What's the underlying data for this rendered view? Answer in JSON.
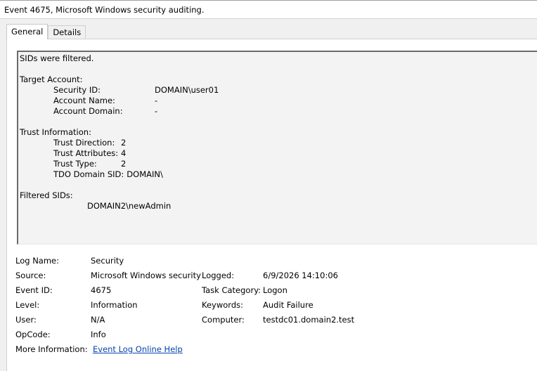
{
  "window": {
    "title": "Event 4675, Microsoft Windows security auditing."
  },
  "tabs": [
    {
      "label": "General",
      "active": true
    },
    {
      "label": "Details",
      "active": false
    }
  ],
  "description": {
    "line1": "SIDs were filtered.",
    "target_account": {
      "heading": "Target Account:",
      "security_id_label": "Security ID:",
      "security_id_value": "DOMAIN\\user01",
      "account_name_label": "Account Name:",
      "account_name_value": "-",
      "account_domain_label": "Account Domain:",
      "account_domain_value": "-"
    },
    "trust_information": {
      "heading": "Trust Information:",
      "direction_label": "Trust Direction:",
      "direction_value": "2",
      "attributes_label": "Trust Attributes:",
      "attributes_value": "4",
      "type_label": "Trust Type:",
      "type_value": "2",
      "tdo_sid_label": "TDO Domain SID:",
      "tdo_sid_value": "DOMAIN\\"
    },
    "filtered_sids": {
      "heading": "Filtered SIDs:",
      "value": "DOMAIN2\\newAdmin"
    }
  },
  "details": {
    "log_name_label": "Log Name:",
    "log_name_value": "Security",
    "source_label": "Source:",
    "source_value": "Microsoft Windows security",
    "logged_label": "Logged:",
    "logged_value": "6/9/2026 14:10:06",
    "event_id_label": "Event ID:",
    "event_id_value": "4675",
    "task_category_label": "Task Category:",
    "task_category_value": "Logon",
    "level_label": "Level:",
    "level_value": "Information",
    "keywords_label": "Keywords:",
    "keywords_value": "Audit Failure",
    "user_label": "User:",
    "user_value": "N/A",
    "computer_label": "Computer:",
    "computer_value": "testdc01.domain2.test",
    "opcode_label": "OpCode:",
    "opcode_value": "Info",
    "more_info_label": "More Information:",
    "more_info_link": "Event Log Online Help"
  },
  "colors": {
    "link": "#0645ad",
    "panel_bg": "#ffffff",
    "window_bg": "#f0f0f0"
  }
}
